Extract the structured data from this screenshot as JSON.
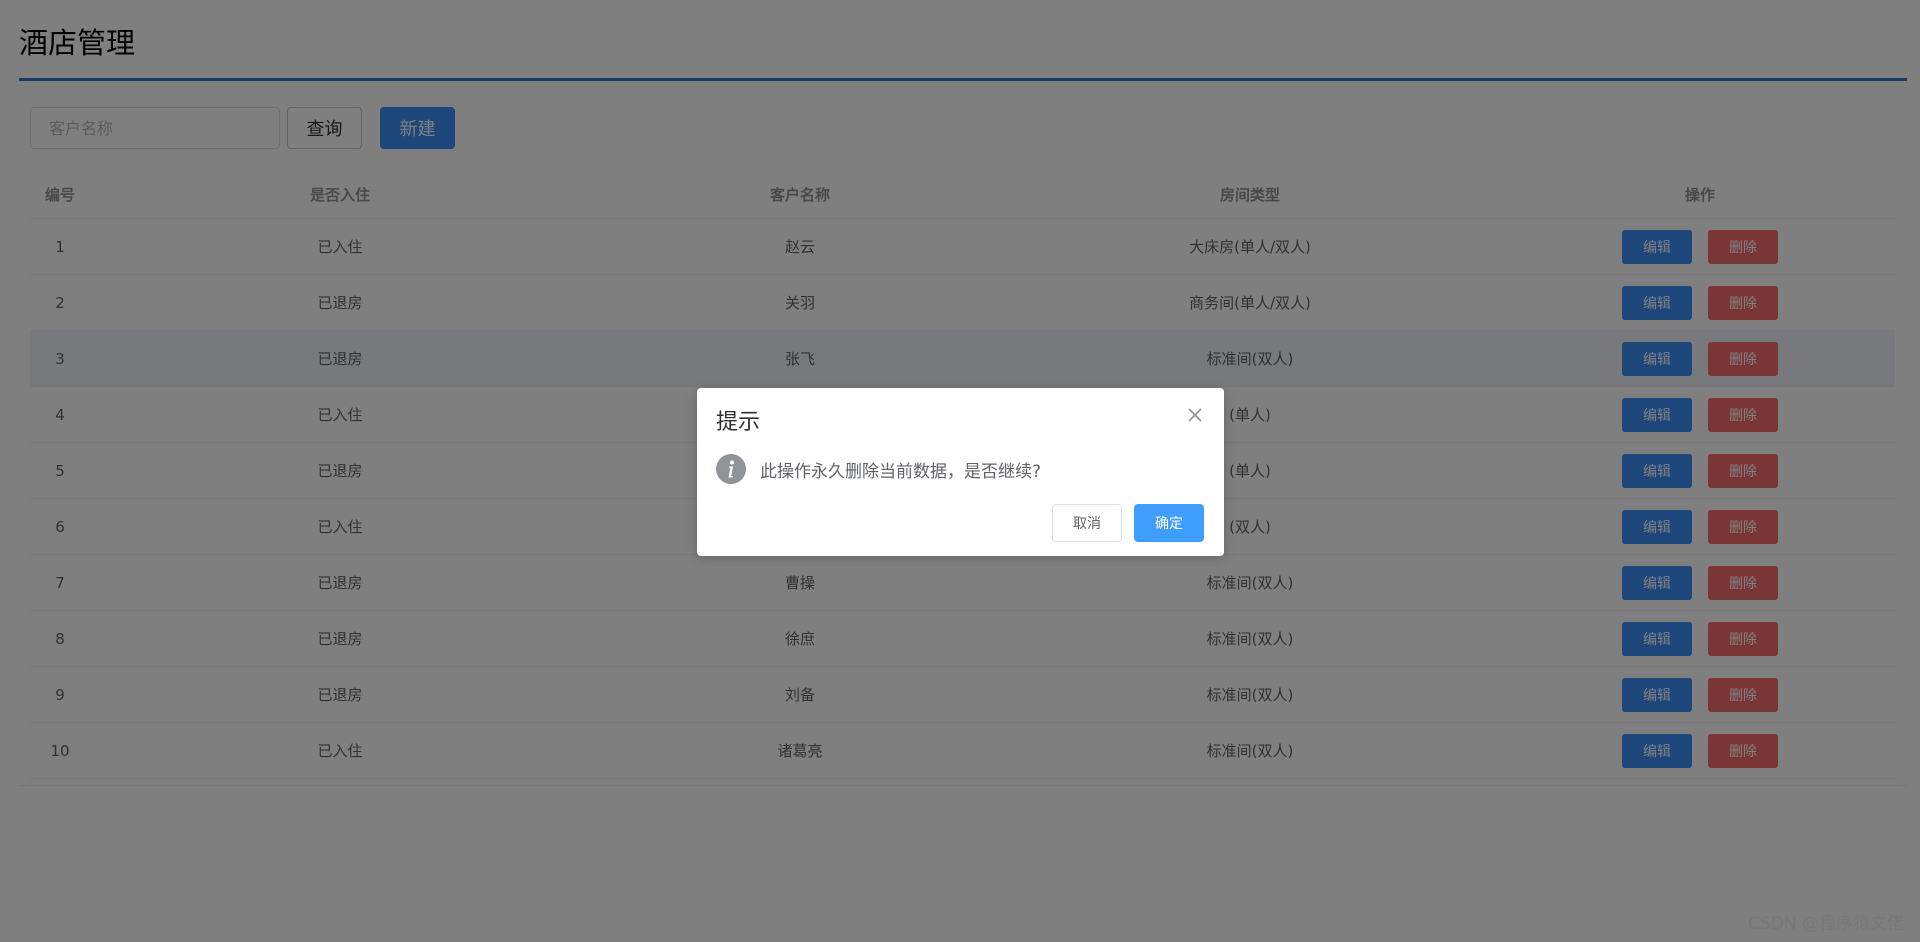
{
  "page": {
    "title": "酒店管理"
  },
  "toolbar": {
    "search_placeholder": "客户名称",
    "query_label": "查询",
    "new_label": "新建"
  },
  "table": {
    "headers": [
      "编号",
      "是否入住",
      "客户名称",
      "房间类型",
      "操作"
    ],
    "rows": [
      {
        "id": "1",
        "status": "已入住",
        "name": "赵云",
        "room": "大床房(单人/双人)"
      },
      {
        "id": "2",
        "status": "已退房",
        "name": "关羽",
        "room": "商务间(单人/双人)"
      },
      {
        "id": "3",
        "status": "已退房",
        "name": "张飞",
        "room": "标准间(双人)"
      },
      {
        "id": "4",
        "status": "已入住",
        "name": "",
        "room": "(单人)"
      },
      {
        "id": "5",
        "status": "已退房",
        "name": "",
        "room": "(单人)"
      },
      {
        "id": "6",
        "status": "已入住",
        "name": "",
        "room": "(双人)"
      },
      {
        "id": "7",
        "status": "已退房",
        "name": "曹操",
        "room": "标准间(双人)"
      },
      {
        "id": "8",
        "status": "已退房",
        "name": "徐庶",
        "room": "标准间(双人)"
      },
      {
        "id": "9",
        "status": "已退房",
        "name": "刘备",
        "room": "标准间(双人)"
      },
      {
        "id": "10",
        "status": "已入住",
        "name": "诸葛亮",
        "room": "标准间(双人)"
      }
    ],
    "edit_label": "编辑",
    "delete_label": "删除"
  },
  "dialog": {
    "title": "提示",
    "message": "此操作永久删除当前数据，是否继续?",
    "cancel_label": "取消",
    "confirm_label": "确定"
  },
  "watermark": "CSDN @程序猿文佬",
  "colors": {
    "accent": "#3d8ff7",
    "danger": "#f56c6c",
    "confirm": "#409eff",
    "title_rule": "#2e78c0"
  }
}
